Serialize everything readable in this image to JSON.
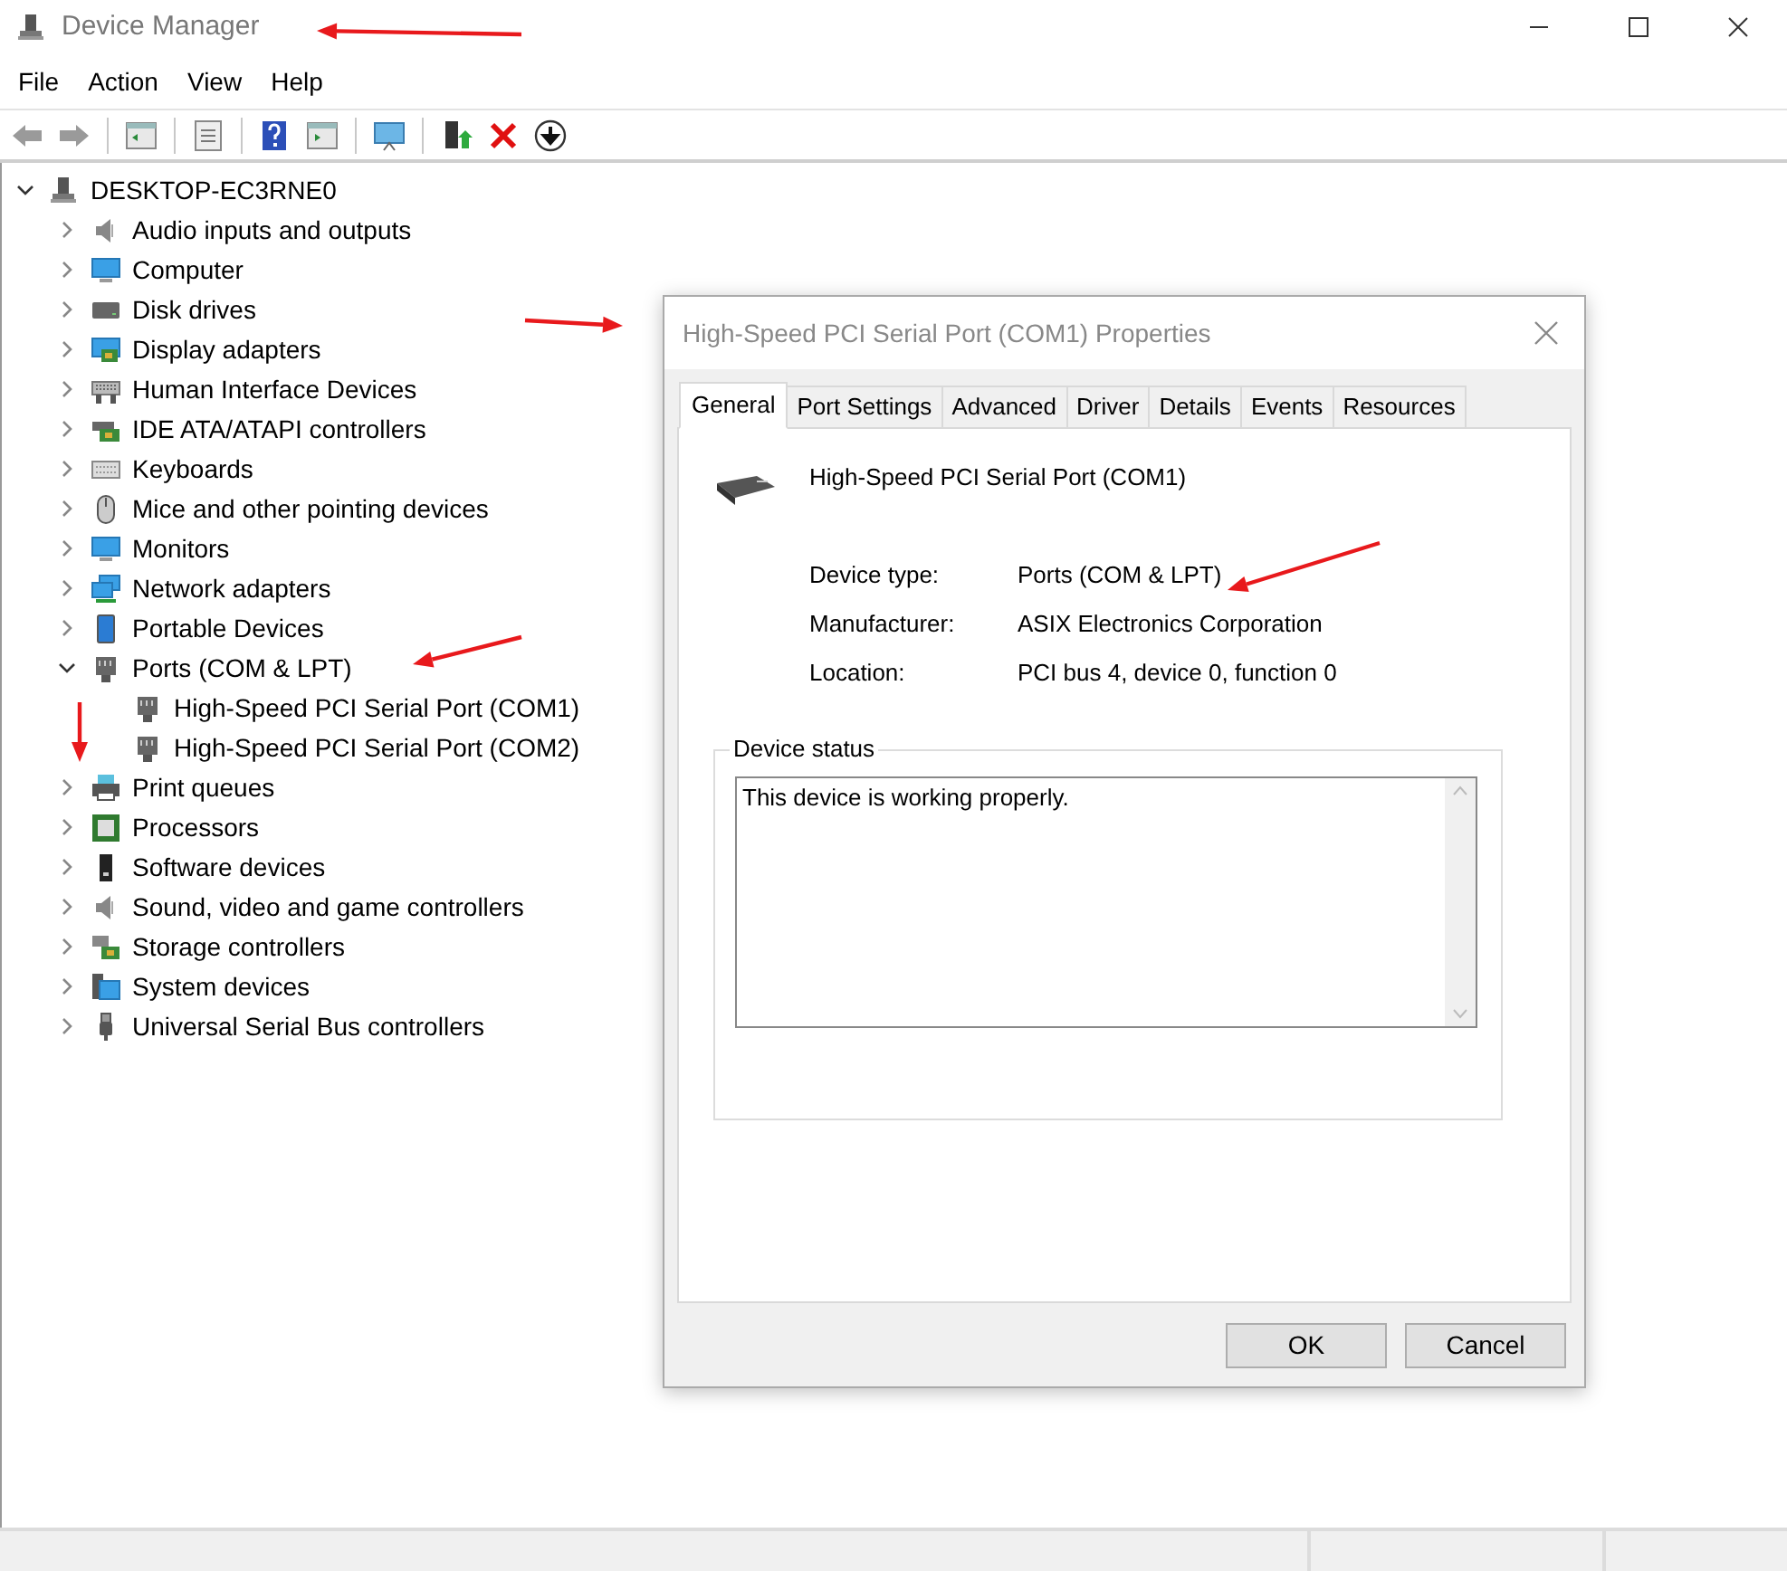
{
  "window": {
    "title": "Device Manager"
  },
  "menu": [
    "File",
    "Action",
    "View",
    "Help"
  ],
  "tree": {
    "label": "DESKTOP-EC3RNE0",
    "expanded": true,
    "children": [
      {
        "label": "Audio inputs and outputs",
        "expanded": false
      },
      {
        "label": "Computer",
        "expanded": false
      },
      {
        "label": "Disk drives",
        "expanded": false
      },
      {
        "label": "Display adapters",
        "expanded": false
      },
      {
        "label": "Human Interface Devices",
        "expanded": false
      },
      {
        "label": "IDE ATA/ATAPI controllers",
        "expanded": false
      },
      {
        "label": "Keyboards",
        "expanded": false
      },
      {
        "label": "Mice and other pointing devices",
        "expanded": false
      },
      {
        "label": "Monitors",
        "expanded": false
      },
      {
        "label": "Network adapters",
        "expanded": false
      },
      {
        "label": "Portable Devices",
        "expanded": false
      },
      {
        "label": "Ports (COM & LPT)",
        "expanded": true,
        "children": [
          {
            "label": "High-Speed PCI Serial Port (COM1)"
          },
          {
            "label": "High-Speed PCI Serial Port (COM2)"
          }
        ]
      },
      {
        "label": "Print queues",
        "expanded": false
      },
      {
        "label": "Processors",
        "expanded": false
      },
      {
        "label": "Software devices",
        "expanded": false
      },
      {
        "label": "Sound, video and game controllers",
        "expanded": false
      },
      {
        "label": "Storage controllers",
        "expanded": false
      },
      {
        "label": "System devices",
        "expanded": false
      },
      {
        "label": "Universal Serial Bus controllers",
        "expanded": false
      }
    ]
  },
  "dialog": {
    "title": "High-Speed PCI Serial Port (COM1) Properties",
    "tabs": [
      {
        "label": "General",
        "selected": true
      },
      {
        "label": "Port Settings",
        "selected": false
      },
      {
        "label": "Advanced",
        "selected": false
      },
      {
        "label": "Driver",
        "selected": false
      },
      {
        "label": "Details",
        "selected": false
      },
      {
        "label": "Events",
        "selected": false
      },
      {
        "label": "Resources",
        "selected": false
      }
    ],
    "device_name": "High-Speed PCI Serial Port (COM1)",
    "properties": [
      {
        "label": "Device type:",
        "value": "Ports (COM & LPT)"
      },
      {
        "label": "Manufacturer:",
        "value": "ASIX Electronics Corporation"
      },
      {
        "label": "Location:",
        "value": "PCI bus 4, device 0, function 0"
      }
    ],
    "status_group": "Device status",
    "status_text": "This device is working properly.",
    "buttons": [
      "OK",
      "Cancel"
    ]
  }
}
